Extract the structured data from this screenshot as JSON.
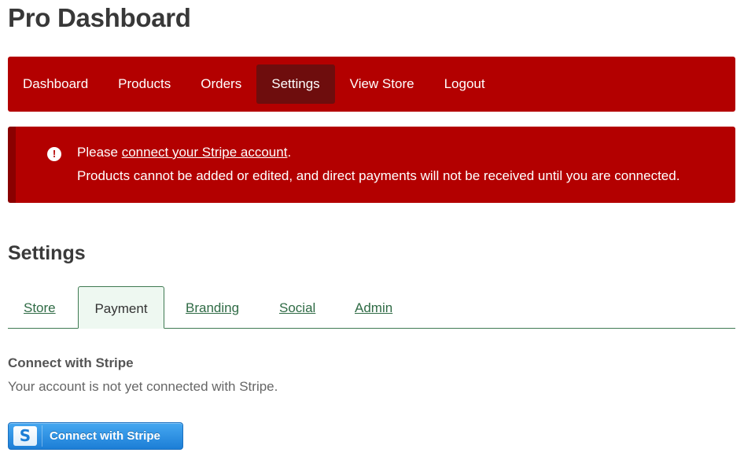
{
  "header": {
    "title": "Pro Dashboard"
  },
  "nav": {
    "items": [
      {
        "label": "Dashboard"
      },
      {
        "label": "Products"
      },
      {
        "label": "Orders"
      },
      {
        "label": "Settings"
      },
      {
        "label": "View Store"
      },
      {
        "label": "Logout"
      }
    ],
    "active": "Settings"
  },
  "alert": {
    "prefix": "Please ",
    "link_text": "connect your Stripe account",
    "suffix": ".",
    "message": "Products cannot be added or edited, and direct payments will not be received until you are connected.",
    "icon": "exclamation-circle-icon"
  },
  "settings": {
    "title": "Settings",
    "tabs": [
      {
        "label": "Store"
      },
      {
        "label": "Payment"
      },
      {
        "label": "Branding"
      },
      {
        "label": "Social"
      },
      {
        "label": "Admin"
      }
    ],
    "active_tab": "Payment"
  },
  "payment": {
    "heading": "Connect with Stripe",
    "status": "Your account is not yet connected with Stripe.",
    "button_icon_letter": "S",
    "button_label": "Connect with Stripe"
  },
  "colors": {
    "brand_red": "#b30000",
    "nav_active": "#6e0d0d",
    "tab_green": "#2f6b45",
    "stripe_blue": "#1c7ed6"
  }
}
